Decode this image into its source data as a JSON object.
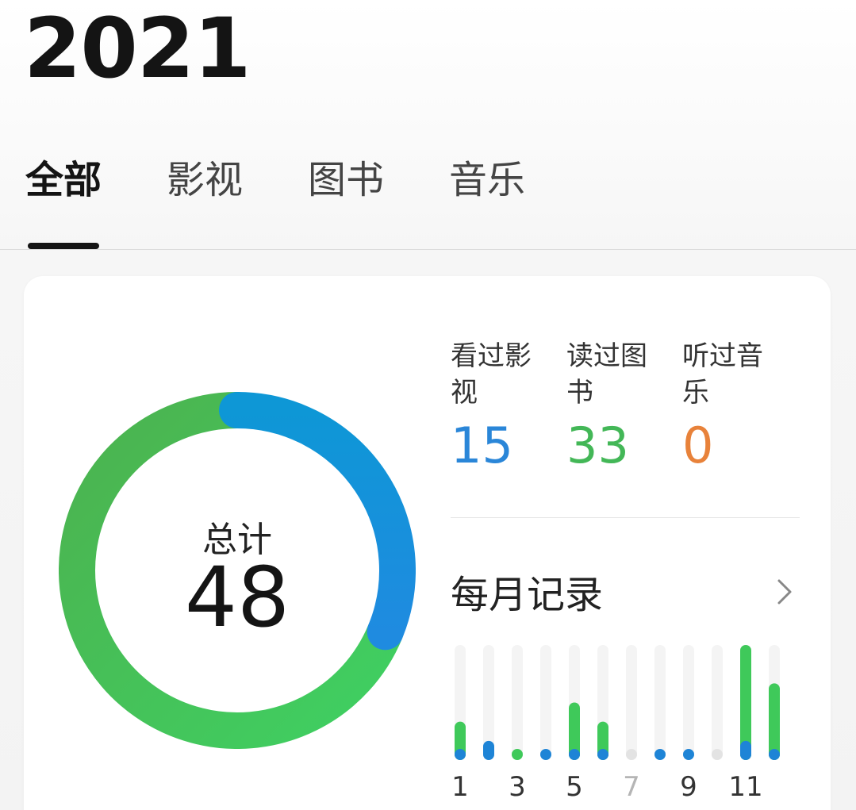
{
  "header": {
    "year": "2021"
  },
  "tabs": [
    {
      "label": "全部",
      "active": true
    },
    {
      "label": "影视",
      "active": false
    },
    {
      "label": "图书",
      "active": false
    },
    {
      "label": "音乐",
      "active": false
    }
  ],
  "summary": {
    "total_label": "总计",
    "total_value": "48",
    "stats": [
      {
        "label": "看过影视",
        "value": "15",
        "color": "#2a86d8"
      },
      {
        "label": "读过图书",
        "value": "33",
        "color": "#43b757"
      },
      {
        "label": "听过音乐",
        "value": "0",
        "color": "#e8823a"
      }
    ]
  },
  "monthly": {
    "title": "每月记录",
    "chevron_icon": "chevron-right-icon"
  },
  "chart_data": {
    "type": "bar",
    "categories": [
      "1",
      "2",
      "3",
      "4",
      "5",
      "6",
      "7",
      "8",
      "9",
      "10",
      "11",
      "12"
    ],
    "x_tick_labels": [
      "1",
      "",
      "3",
      "",
      "5",
      "",
      "7",
      "",
      "9",
      "",
      "11",
      ""
    ],
    "series": [
      {
        "name": "影视",
        "values": [
          1,
          2,
          0,
          1,
          1,
          1,
          0,
          1,
          1,
          0,
          2,
          1
        ],
        "color": "#1e84d6"
      },
      {
        "name": "图书",
        "values": [
          3,
          0,
          1,
          0,
          5,
          3,
          0,
          0,
          0,
          0,
          10,
          7
        ],
        "color": "#3fc95a"
      }
    ],
    "stacked": true,
    "ylim": [
      0,
      12
    ]
  },
  "donut": {
    "movies_color": "#1f8be0",
    "books_color": "#3fd062",
    "track_color": "#e9e9e9"
  }
}
